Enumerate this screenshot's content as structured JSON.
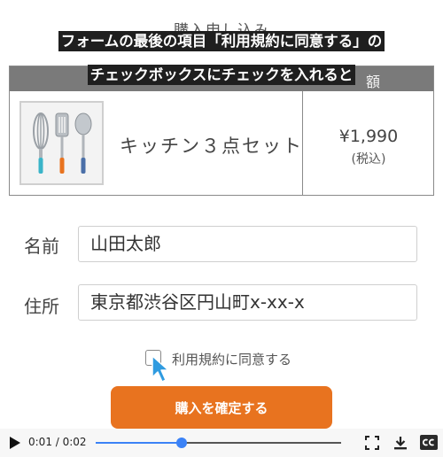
{
  "page": {
    "heading": "購入申し込み"
  },
  "captions": [
    "フォームの最後の項目「利用規約に同意する」の",
    "チェックボックスにチェックを入れると"
  ],
  "order_table": {
    "price_header": "額",
    "product": {
      "image_icon": "kitchen-utensils-icon",
      "name": "キッチン３点セット"
    },
    "price": "¥1,990",
    "price_note": "(税込)"
  },
  "form": {
    "name_label": "名前",
    "name_value": "山田太郎",
    "address_label": "住所",
    "address_value": "東京都渋谷区円山町x-xx-x",
    "agree_label": "利用規約に同意する",
    "agree_checked": false
  },
  "confirm_button": {
    "label": "購入を確定する",
    "color": "#e8731f"
  },
  "video": {
    "time": "0:01 / 0:02",
    "progress_fraction": 0.35,
    "accent_color": "#3b82f6",
    "icons": [
      "play-icon",
      "fullscreen-icon",
      "download-icon",
      "closed-captions-icon"
    ]
  }
}
